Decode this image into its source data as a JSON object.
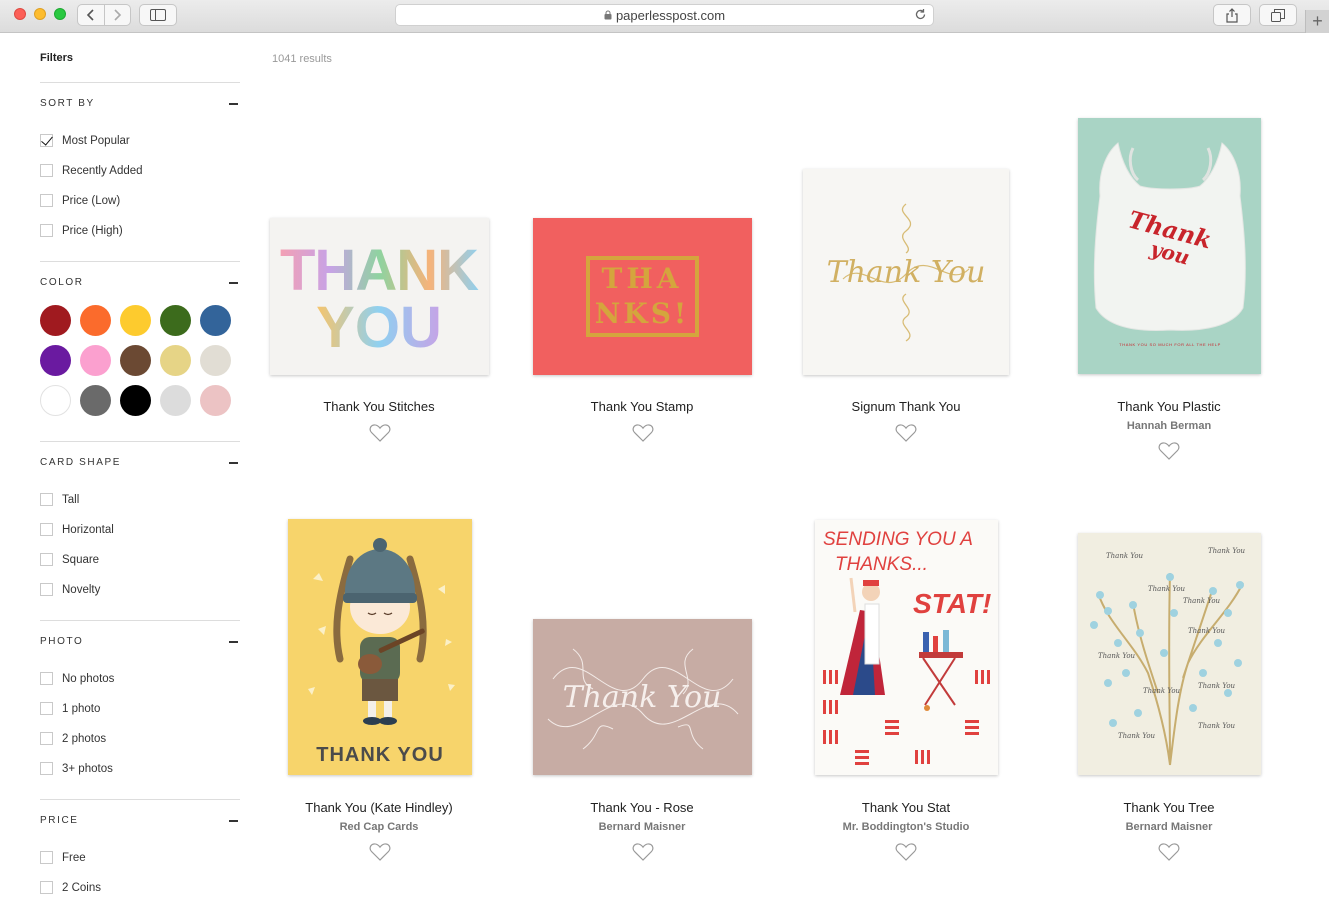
{
  "browser": {
    "url": "paperlesspost.com"
  },
  "sidebar": {
    "title": "Filters",
    "sections": [
      {
        "heading": "SORT BY",
        "options": [
          {
            "label": "Most Popular",
            "checked": true
          },
          {
            "label": "Recently Added",
            "checked": false
          },
          {
            "label": "Price (Low)",
            "checked": false
          },
          {
            "label": "Price (High)",
            "checked": false
          }
        ]
      },
      {
        "heading": "COLOR"
      },
      {
        "heading": "CARD SHAPE",
        "options": [
          {
            "label": "Tall",
            "checked": false
          },
          {
            "label": "Horizontal",
            "checked": false
          },
          {
            "label": "Square",
            "checked": false
          },
          {
            "label": "Novelty",
            "checked": false
          }
        ]
      },
      {
        "heading": "PHOTO",
        "options": [
          {
            "label": "No photos",
            "checked": false
          },
          {
            "label": "1 photo",
            "checked": false
          },
          {
            "label": "2 photos",
            "checked": false
          },
          {
            "label": "3+ photos",
            "checked": false
          }
        ]
      },
      {
        "heading": "PRICE",
        "options": [
          {
            "label": "Free",
            "checked": false
          },
          {
            "label": "2 Coins",
            "checked": false
          }
        ]
      }
    ],
    "colors": [
      "#a01a1f",
      "#fb6b2c",
      "#fdcb2e",
      "#3c6b1c",
      "#33649a",
      "#6a1aa0",
      "#fba0cf",
      "#6b4933",
      "#e6d486",
      "#e1ddd4",
      "#ffffff",
      "#6a6a6a",
      "#000000",
      "#dcdcdc",
      "#ecc3c4"
    ]
  },
  "results": {
    "count_text": "1041 results",
    "cards": [
      {
        "title": "Thank You Stitches",
        "maker": ""
      },
      {
        "title": "Thank You Stamp",
        "maker": ""
      },
      {
        "title": "Signum Thank You",
        "maker": ""
      },
      {
        "title": "Thank You Plastic",
        "maker": "Hannah Berman"
      },
      {
        "title": "Thank You (Kate Hindley)",
        "maker": "Red Cap Cards"
      },
      {
        "title": "Thank You - Rose",
        "maker": "Bernard Maisner"
      },
      {
        "title": "Thank You Stat",
        "maker": "Mr. Boddington's Studio"
      },
      {
        "title": "Thank You Tree",
        "maker": "Bernard Maisner"
      }
    ],
    "card_art": {
      "stitches": {
        "line1": "THANK",
        "line2": "YOU"
      },
      "stamp": {
        "line1": "THA",
        "line2": "NKS!"
      },
      "signum": {
        "text": "Thank You"
      },
      "plastic": {
        "text1": "Thank",
        "text2": "you",
        "small": "THANK YOU SO MUCH FOR ALL THE HELP"
      },
      "hindley": {
        "text": "THANK YOU"
      },
      "rose": {
        "text": "Thank You"
      },
      "stat": {
        "line1": "SENDING YOU A",
        "line2": "THANKS...",
        "line3": "STAT!"
      },
      "tree": {
        "word": "Thank You"
      }
    }
  }
}
